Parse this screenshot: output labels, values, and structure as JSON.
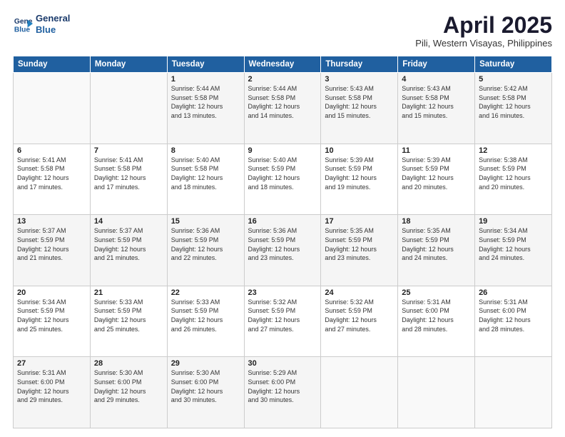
{
  "logo": {
    "line1": "General",
    "line2": "Blue"
  },
  "title": "April 2025",
  "location": "Pili, Western Visayas, Philippines",
  "weekdays": [
    "Sunday",
    "Monday",
    "Tuesday",
    "Wednesday",
    "Thursday",
    "Friday",
    "Saturday"
  ],
  "weeks": [
    [
      {
        "day": "",
        "info": ""
      },
      {
        "day": "",
        "info": ""
      },
      {
        "day": "1",
        "info": "Sunrise: 5:44 AM\nSunset: 5:58 PM\nDaylight: 12 hours\nand 13 minutes."
      },
      {
        "day": "2",
        "info": "Sunrise: 5:44 AM\nSunset: 5:58 PM\nDaylight: 12 hours\nand 14 minutes."
      },
      {
        "day": "3",
        "info": "Sunrise: 5:43 AM\nSunset: 5:58 PM\nDaylight: 12 hours\nand 15 minutes."
      },
      {
        "day": "4",
        "info": "Sunrise: 5:43 AM\nSunset: 5:58 PM\nDaylight: 12 hours\nand 15 minutes."
      },
      {
        "day": "5",
        "info": "Sunrise: 5:42 AM\nSunset: 5:58 PM\nDaylight: 12 hours\nand 16 minutes."
      }
    ],
    [
      {
        "day": "6",
        "info": "Sunrise: 5:41 AM\nSunset: 5:58 PM\nDaylight: 12 hours\nand 17 minutes."
      },
      {
        "day": "7",
        "info": "Sunrise: 5:41 AM\nSunset: 5:58 PM\nDaylight: 12 hours\nand 17 minutes."
      },
      {
        "day": "8",
        "info": "Sunrise: 5:40 AM\nSunset: 5:58 PM\nDaylight: 12 hours\nand 18 minutes."
      },
      {
        "day": "9",
        "info": "Sunrise: 5:40 AM\nSunset: 5:59 PM\nDaylight: 12 hours\nand 18 minutes."
      },
      {
        "day": "10",
        "info": "Sunrise: 5:39 AM\nSunset: 5:59 PM\nDaylight: 12 hours\nand 19 minutes."
      },
      {
        "day": "11",
        "info": "Sunrise: 5:39 AM\nSunset: 5:59 PM\nDaylight: 12 hours\nand 20 minutes."
      },
      {
        "day": "12",
        "info": "Sunrise: 5:38 AM\nSunset: 5:59 PM\nDaylight: 12 hours\nand 20 minutes."
      }
    ],
    [
      {
        "day": "13",
        "info": "Sunrise: 5:37 AM\nSunset: 5:59 PM\nDaylight: 12 hours\nand 21 minutes."
      },
      {
        "day": "14",
        "info": "Sunrise: 5:37 AM\nSunset: 5:59 PM\nDaylight: 12 hours\nand 21 minutes."
      },
      {
        "day": "15",
        "info": "Sunrise: 5:36 AM\nSunset: 5:59 PM\nDaylight: 12 hours\nand 22 minutes."
      },
      {
        "day": "16",
        "info": "Sunrise: 5:36 AM\nSunset: 5:59 PM\nDaylight: 12 hours\nand 23 minutes."
      },
      {
        "day": "17",
        "info": "Sunrise: 5:35 AM\nSunset: 5:59 PM\nDaylight: 12 hours\nand 23 minutes."
      },
      {
        "day": "18",
        "info": "Sunrise: 5:35 AM\nSunset: 5:59 PM\nDaylight: 12 hours\nand 24 minutes."
      },
      {
        "day": "19",
        "info": "Sunrise: 5:34 AM\nSunset: 5:59 PM\nDaylight: 12 hours\nand 24 minutes."
      }
    ],
    [
      {
        "day": "20",
        "info": "Sunrise: 5:34 AM\nSunset: 5:59 PM\nDaylight: 12 hours\nand 25 minutes."
      },
      {
        "day": "21",
        "info": "Sunrise: 5:33 AM\nSunset: 5:59 PM\nDaylight: 12 hours\nand 25 minutes."
      },
      {
        "day": "22",
        "info": "Sunrise: 5:33 AM\nSunset: 5:59 PM\nDaylight: 12 hours\nand 26 minutes."
      },
      {
        "day": "23",
        "info": "Sunrise: 5:32 AM\nSunset: 5:59 PM\nDaylight: 12 hours\nand 27 minutes."
      },
      {
        "day": "24",
        "info": "Sunrise: 5:32 AM\nSunset: 5:59 PM\nDaylight: 12 hours\nand 27 minutes."
      },
      {
        "day": "25",
        "info": "Sunrise: 5:31 AM\nSunset: 6:00 PM\nDaylight: 12 hours\nand 28 minutes."
      },
      {
        "day": "26",
        "info": "Sunrise: 5:31 AM\nSunset: 6:00 PM\nDaylight: 12 hours\nand 28 minutes."
      }
    ],
    [
      {
        "day": "27",
        "info": "Sunrise: 5:31 AM\nSunset: 6:00 PM\nDaylight: 12 hours\nand 29 minutes."
      },
      {
        "day": "28",
        "info": "Sunrise: 5:30 AM\nSunset: 6:00 PM\nDaylight: 12 hours\nand 29 minutes."
      },
      {
        "day": "29",
        "info": "Sunrise: 5:30 AM\nSunset: 6:00 PM\nDaylight: 12 hours\nand 30 minutes."
      },
      {
        "day": "30",
        "info": "Sunrise: 5:29 AM\nSunset: 6:00 PM\nDaylight: 12 hours\nand 30 minutes."
      },
      {
        "day": "",
        "info": ""
      },
      {
        "day": "",
        "info": ""
      },
      {
        "day": "",
        "info": ""
      }
    ]
  ]
}
